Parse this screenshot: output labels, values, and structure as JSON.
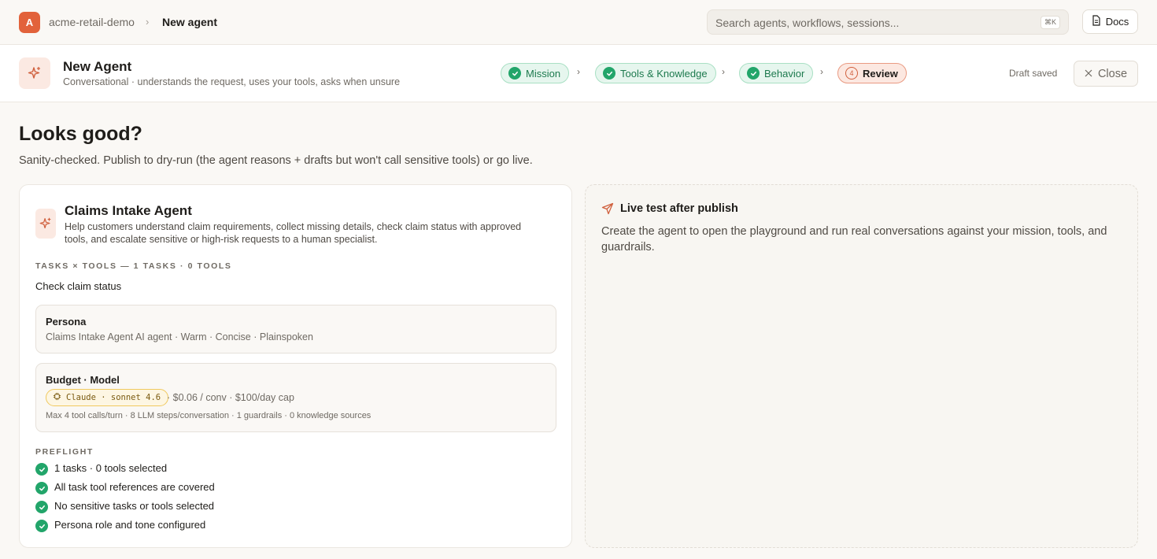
{
  "topbar": {
    "workspace_initial": "A",
    "workspace_name": "acme-retail-demo",
    "breadcrumb_sep": "›",
    "current_page": "New agent",
    "search_placeholder": "Search agents, workflows, sessions...",
    "search_shortcut": "⌘K",
    "docs_label": "Docs"
  },
  "header": {
    "title": "New Agent",
    "subtitle": "Conversational · understands the request, uses your tools, asks when unsure",
    "steps": [
      {
        "label": "Mission",
        "state": "done"
      },
      {
        "label": "Tools & Knowledge",
        "state": "done"
      },
      {
        "label": "Behavior",
        "state": "done"
      },
      {
        "label": "Review",
        "state": "current",
        "number": "4"
      }
    ],
    "step_sep": "›",
    "draft_status": "Draft saved",
    "close_label": "Close"
  },
  "page": {
    "title": "Looks good?",
    "subtitle": "Sanity-checked. Publish to dry-run (the agent reasons + drafts but won't call sensitive tools) or go live."
  },
  "summary": {
    "agent_name": "Claims Intake Agent",
    "description_line1": "Help customers understand claim requirements, collect missing details, check claim status with approved",
    "description_line2": "tools, and escalate sensitive or high-risk requests to a human specialist.",
    "tasks_label": "TASKS × TOOLS — 1 TASKS · 0 TOOLS",
    "tasks": [
      "Check claim status"
    ],
    "persona": {
      "title": "Persona",
      "text": "Claims Intake Agent AI agent · Warm · Concise · Plainspoken"
    },
    "budget": {
      "title": "Budget · Model",
      "model": "Claude · sonnet 4.6",
      "cost": "· $0.06 / conv · $100/day cap",
      "limits": "Max 4 tool calls/turn · 8 LLM steps/conversation · 1 guardrails · 0 knowledge sources"
    },
    "preflight_label": "PREFLIGHT",
    "preflight": [
      "1 tasks · 0 tools selected",
      "All task tool references are covered",
      "No sensitive tasks or tools selected",
      "Persona role and tone configured"
    ]
  },
  "live_test": {
    "title": "Live test after publish",
    "description": "Create the agent to open the playground and run real conversations against your mission, tools, and guardrails."
  },
  "colors": {
    "accent": "#e2623b",
    "success": "#22a56a",
    "background": "#faf8f5"
  }
}
